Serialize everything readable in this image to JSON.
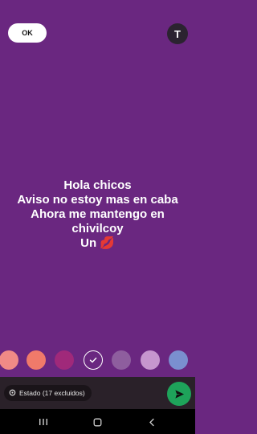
{
  "header": {
    "ok_label": "OK",
    "text_tool_label": "T"
  },
  "status": {
    "lines": [
      "Hola chicos",
      "Aviso no estoy mas en caba",
      "Ahora me mantengo en",
      "chivilcoy"
    ],
    "last_line_text": "Un",
    "last_line_emoji": "💋"
  },
  "palette": {
    "colors": [
      "#f08a86",
      "#f07a6a",
      "#a0297a",
      "#6a2780",
      "#8e5e9e",
      "#c696ce",
      "#7a8fcf"
    ],
    "selected_index": 3
  },
  "footer": {
    "audience_label": "Estado (17 excluidos)",
    "audience_icon": "status-settings-icon",
    "send_icon": "send-icon",
    "send_color": "#1ea35a"
  },
  "navigation": {
    "icons": [
      "recent-apps-icon",
      "home-icon",
      "back-icon"
    ]
  }
}
